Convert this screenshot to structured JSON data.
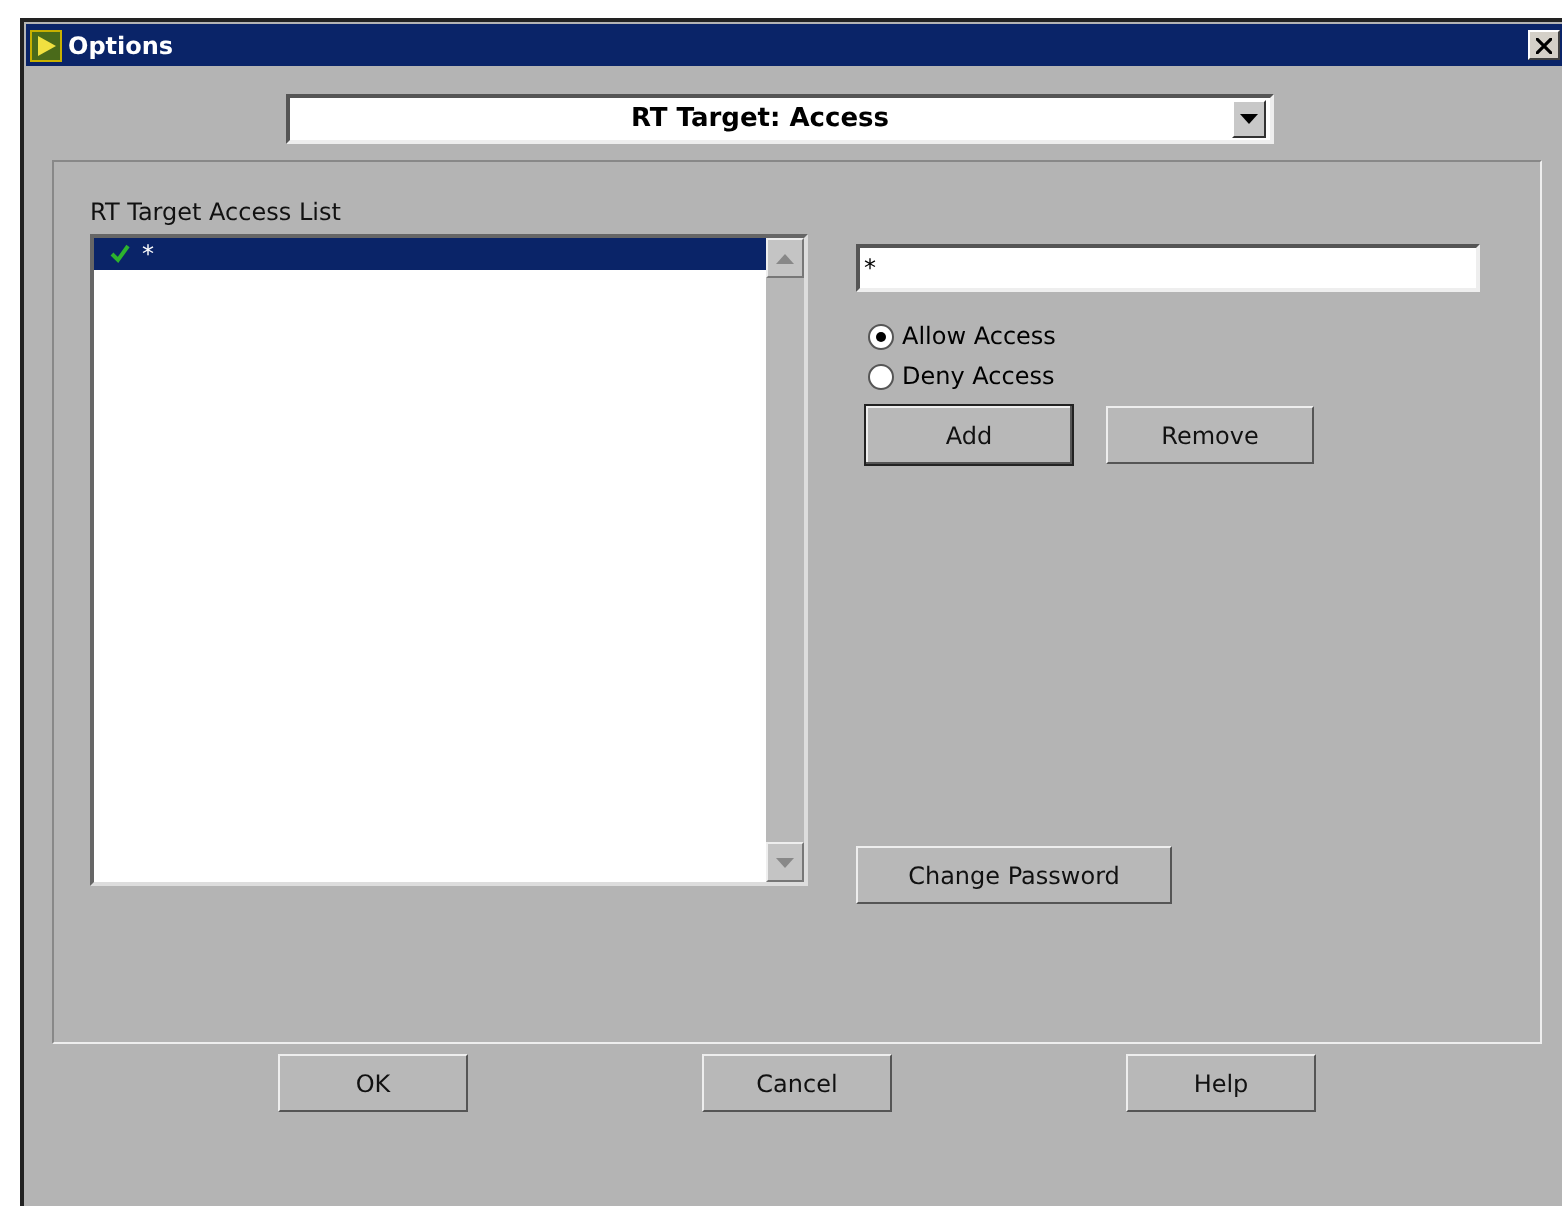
{
  "window": {
    "title": "Options"
  },
  "category_dropdown": {
    "value": "RT Target: Access"
  },
  "access_list": {
    "label": "RT Target Access List",
    "items": [
      {
        "text": "*",
        "allowed": true,
        "selected": true
      }
    ]
  },
  "address_field": {
    "value": "*"
  },
  "access_options": [
    {
      "label": "Allow Access",
      "selected": true
    },
    {
      "label": "Deny Access",
      "selected": false
    }
  ],
  "list_buttons": [
    {
      "label": "Add",
      "default": true
    },
    {
      "label": "Remove",
      "default": false
    }
  ],
  "password_button": {
    "label": "Change Password"
  },
  "dialog_buttons": [
    "OK",
    "Cancel",
    "Help"
  ]
}
